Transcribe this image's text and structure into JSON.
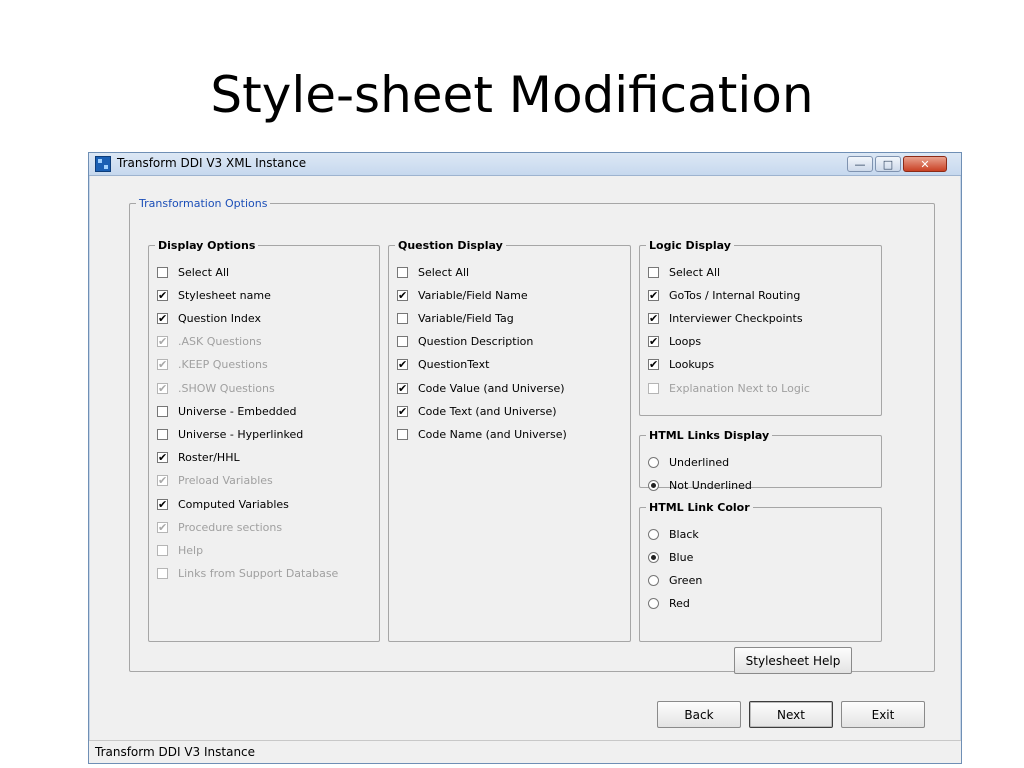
{
  "slide": {
    "title": "Style-sheet Modification"
  },
  "window": {
    "title": "Transform DDI V3 XML Instance",
    "icon": "app-icon",
    "controls": {
      "minimize": "minimize-icon",
      "maximize": "maximize-icon",
      "close": "close-icon"
    }
  },
  "transformation_options": {
    "legend": "Transformation Options",
    "display_options": {
      "legend": "Display Options",
      "items": [
        {
          "label": "Select All",
          "checked": false,
          "enabled": true
        },
        {
          "label": "Stylesheet name",
          "checked": true,
          "enabled": true
        },
        {
          "label": "Question Index",
          "checked": true,
          "enabled": true
        },
        {
          "label": ".ASK Questions",
          "checked": true,
          "enabled": false
        },
        {
          "label": ".KEEP Questions",
          "checked": true,
          "enabled": false
        },
        {
          "label": ".SHOW Questions",
          "checked": true,
          "enabled": false
        },
        {
          "label": "Universe - Embedded",
          "checked": false,
          "enabled": true
        },
        {
          "label": "Universe - Hyperlinked",
          "checked": false,
          "enabled": true
        },
        {
          "label": "Roster/HHL",
          "checked": true,
          "enabled": true
        },
        {
          "label": "Preload Variables",
          "checked": true,
          "enabled": false
        },
        {
          "label": "Computed Variables",
          "checked": true,
          "enabled": true
        },
        {
          "label": "Procedure sections",
          "checked": true,
          "enabled": false
        },
        {
          "label": "Help",
          "checked": false,
          "enabled": false
        },
        {
          "label": "Links from Support Database",
          "checked": false,
          "enabled": false
        }
      ]
    },
    "question_display": {
      "legend": "Question Display",
      "items": [
        {
          "label": "Select All",
          "checked": false,
          "enabled": true
        },
        {
          "label": "Variable/Field Name",
          "checked": true,
          "enabled": true
        },
        {
          "label": "Variable/Field Tag",
          "checked": false,
          "enabled": true
        },
        {
          "label": "Question Description",
          "checked": false,
          "enabled": true
        },
        {
          "label": "QuestionText",
          "checked": true,
          "enabled": true
        },
        {
          "label": "Code Value (and Universe)",
          "checked": true,
          "enabled": true
        },
        {
          "label": "Code Text (and Universe)",
          "checked": true,
          "enabled": true
        },
        {
          "label": "Code Name (and Universe)",
          "checked": false,
          "enabled": true
        }
      ]
    },
    "logic_display": {
      "legend": "Logic Display",
      "items": [
        {
          "label": "Select All",
          "checked": false,
          "enabled": true
        },
        {
          "label": "GoTos / Internal Routing",
          "checked": true,
          "enabled": true
        },
        {
          "label": "Interviewer Checkpoints",
          "checked": true,
          "enabled": true
        },
        {
          "label": "Loops",
          "checked": true,
          "enabled": true
        },
        {
          "label": "Lookups",
          "checked": true,
          "enabled": true
        },
        {
          "label": "Explanation Next to Logic",
          "checked": false,
          "enabled": false
        }
      ]
    },
    "html_links_display": {
      "legend": "HTML Links Display",
      "options": [
        {
          "label": "Underlined",
          "selected": false
        },
        {
          "label": "Not Underlined",
          "selected": true
        }
      ]
    },
    "html_link_color": {
      "legend": "HTML Link Color",
      "options": [
        {
          "label": "Black",
          "selected": false
        },
        {
          "label": "Blue",
          "selected": true
        },
        {
          "label": "Green",
          "selected": false
        },
        {
          "label": "Red",
          "selected": false
        }
      ]
    },
    "stylesheet_help_label": "Stylesheet Help"
  },
  "buttons": {
    "back": "Back",
    "next": "Next",
    "exit": "Exit"
  },
  "status_bar": {
    "text": "Transform DDI V3 Instance"
  }
}
